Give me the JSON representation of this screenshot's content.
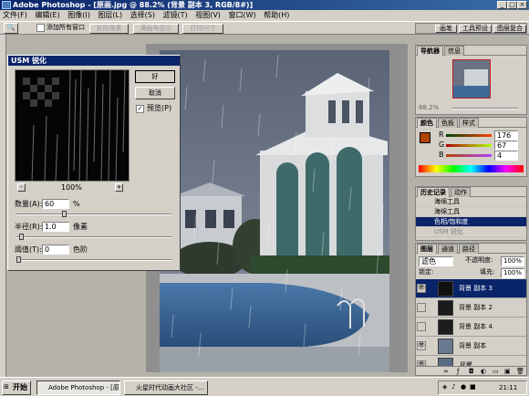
{
  "window": {
    "title": "Adobe Photoshop - [原画.jpg @ 88.2% (背景 副本 3, RGB/8#)]"
  },
  "menu": [
    "文件(F)",
    "编辑(E)",
    "图像(I)",
    "图层(L)",
    "选择(S)",
    "滤镜(T)",
    "视图(V)",
    "窗口(W)",
    "帮助(H)"
  ],
  "options": {
    "checkbox_label": "添加所有窗口",
    "buttons": [
      "实际像素",
      "满画布显示",
      "打印尺寸"
    ],
    "palette_tabs": [
      "画笔",
      "工具预设",
      "图层复合"
    ]
  },
  "dialog": {
    "title": "USM 锐化",
    "ok": "好",
    "cancel": "取消",
    "preview_label": "预览(P)",
    "zoom": "100%",
    "zoom_out": "-",
    "zoom_in": "+",
    "amount_label": "数量(A):",
    "amount_value": "60",
    "amount_unit": "%",
    "radius_label": "半径(R):",
    "radius_value": "1.0",
    "radius_unit": "像素",
    "threshold_label": "阈值(T):",
    "threshold_value": "0",
    "threshold_unit": "色阶",
    "amount_level": 0.3,
    "radius_level": 0.02,
    "threshold_level": 0.0
  },
  "navigator": {
    "tabs": [
      "导航器",
      "信息"
    ],
    "zoom": "88.2%"
  },
  "color": {
    "tabs": [
      "颜色",
      "色板",
      "样式"
    ],
    "r": "176",
    "g": "67",
    "b": "4",
    "r_label": "R",
    "g_label": "G",
    "b_label": "B"
  },
  "history": {
    "tabs": [
      "历史记录",
      "动作"
    ],
    "items": [
      {
        "label": "海绵工具",
        "state": "normal"
      },
      {
        "label": "海绵工具",
        "state": "normal"
      },
      {
        "label": "色相/饱和度",
        "state": "selected"
      },
      {
        "label": "USM 锐化",
        "state": "dim"
      }
    ]
  },
  "layers": {
    "tabs": [
      "图层",
      "通道",
      "路径"
    ],
    "blend_mode": "滤色",
    "opacity_label": "不透明度:",
    "opacity_value": "100%",
    "lock_label": "锁定:",
    "fill_label": "填充:",
    "fill_value": "100%",
    "items": [
      {
        "name": "背景 副本 3",
        "selected": true
      },
      {
        "name": "背景 副本 2",
        "selected": false
      },
      {
        "name": "背景 副本 4",
        "selected": false
      },
      {
        "name": "背景 副本",
        "selected": false
      },
      {
        "name": "背景",
        "selected": false
      }
    ]
  },
  "taskbar": {
    "start": "开始",
    "tasks": [
      "Adobe Photoshop - [原画...",
      "火星时代动画大社区 -..."
    ],
    "clock": "21:11"
  },
  "colors": {
    "accent": "#0a246a",
    "foreground_swatch": "#b04304"
  }
}
